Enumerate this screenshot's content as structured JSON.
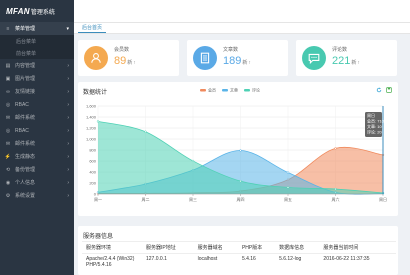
{
  "brand": {
    "logo": "MFAN",
    "subtitle": "管理系统"
  },
  "sidebar": {
    "items": [
      {
        "label": "菜单管理",
        "icon": "menu-icon",
        "active": true,
        "sub": [
          "后台菜单",
          "前台菜单"
        ]
      },
      {
        "label": "内容管理",
        "icon": "content-icon"
      },
      {
        "label": "图片管理",
        "icon": "image-icon"
      },
      {
        "label": "友情链接",
        "icon": "link-icon"
      },
      {
        "label": "RBAC",
        "icon": "rbac-icon"
      },
      {
        "label": "邮件系统",
        "icon": "mail-icon"
      },
      {
        "label": "RBAC",
        "icon": "rbac-icon"
      },
      {
        "label": "邮件系统",
        "icon": "mail-icon"
      },
      {
        "label": "生成静态",
        "icon": "static-icon"
      },
      {
        "label": "备份管理",
        "icon": "backup-icon"
      },
      {
        "label": "个人信息",
        "icon": "user-icon"
      },
      {
        "label": "系统设置",
        "icon": "settings-icon"
      }
    ]
  },
  "tabbar": {
    "active": "后台首页"
  },
  "stats": [
    {
      "label": "会员数",
      "value": "89",
      "unit": "新",
      "icon": "user-icon",
      "color": "#f4a950"
    },
    {
      "label": "文章数",
      "value": "189",
      "unit": "新",
      "icon": "document-icon",
      "color": "#5aa9e6"
    },
    {
      "label": "评论数",
      "value": "221",
      "unit": "新",
      "icon": "comment-icon",
      "color": "#48c9b0"
    }
  ],
  "chart_panel": {
    "title": "数据统计",
    "tools": [
      "refresh-icon",
      "save-icon"
    ]
  },
  "chart_data": {
    "type": "area",
    "categories": [
      "周一",
      "周二",
      "周三",
      "周四",
      "周五",
      "周六",
      "周日"
    ],
    "y_ticks": [
      "0",
      "200",
      "400",
      "600",
      "800",
      "1,000",
      "1,200",
      "1,400",
      "1,600"
    ],
    "ylim": [
      0,
      1600
    ],
    "series": [
      {
        "name": "会员",
        "color": "#f08a5d",
        "values": [
          10,
          12,
          21,
          54,
          260,
          830,
          710
        ]
      },
      {
        "name": "文章",
        "color": "#5ab4e8",
        "values": [
          30,
          182,
          434,
          791,
          390,
          30,
          10
        ]
      },
      {
        "name": "评论",
        "color": "#4fd1b5",
        "values": [
          1320,
          1132,
          601,
          234,
          120,
          90,
          20
        ]
      }
    ],
    "legend_position": "top-center",
    "grid": true,
    "tooltip": {
      "title": "周日",
      "rows": [
        {
          "name": "会员",
          "value": "710"
        },
        {
          "name": "文章",
          "value": "10"
        },
        {
          "name": "评论",
          "value": "20"
        }
      ]
    }
  },
  "server_panel": {
    "title": "服务器信息",
    "columns": [
      "服务器环境",
      "服务器IP地址",
      "服务器域名",
      "PHP版本",
      "数据库信息",
      "服务器当前时间"
    ],
    "rows": [
      [
        "Apache/2.4.4 (Win32) PHP/5.4.16",
        "127.0.0.1",
        "localhost",
        "5.4.16",
        "5.6.12-log",
        "2016-06-22 11:37:35"
      ]
    ]
  }
}
